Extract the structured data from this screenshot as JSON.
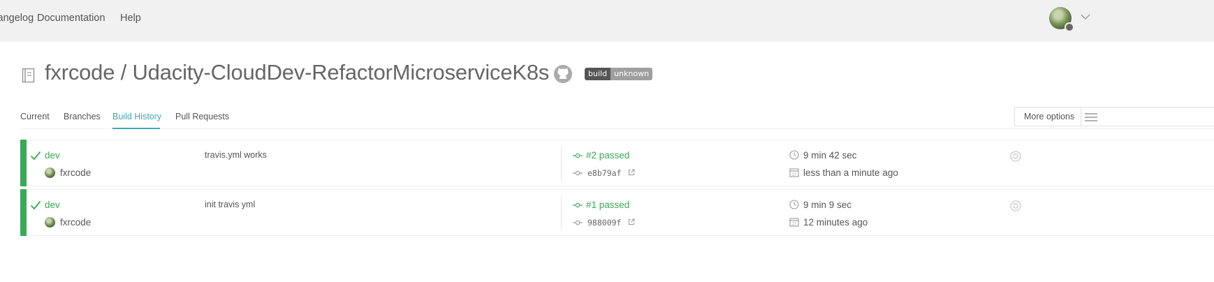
{
  "topnav": {
    "changelog": "Changelog",
    "documentation": "Documentation",
    "help": "Help"
  },
  "repo": {
    "title": "fxrcode / Udacity-CloudDev-RefactorMicroserviceK8s",
    "badge_left": "build",
    "badge_right": "unknown"
  },
  "tabs": [
    "Current",
    "Branches",
    "Build History",
    "Pull Requests"
  ],
  "active_tab": "Build History",
  "more_options": "More options",
  "builds": [
    {
      "branch": "dev",
      "author": "fxrcode",
      "message": "travis.yml works",
      "status": "#2 passed",
      "sha": "e8b79af",
      "duration": "9 min 42 sec",
      "finished": "less than a minute ago"
    },
    {
      "branch": "dev",
      "author": "fxrcode",
      "message": "init travis yml",
      "status": "#1 passed",
      "sha": "988009f",
      "duration": "9 min 9 sec",
      "finished": "12 minutes ago"
    }
  ],
  "colors": {
    "passed": "#39aa56",
    "accent": "#3eaaaf",
    "topbar": "#f1f1f1"
  },
  "icons": [
    "repo-icon",
    "github-icon",
    "check-icon",
    "commit-icon",
    "external-link-icon",
    "clock-icon",
    "calendar-icon",
    "restart-icon",
    "hamburger-icon",
    "chevron-down-icon"
  ]
}
